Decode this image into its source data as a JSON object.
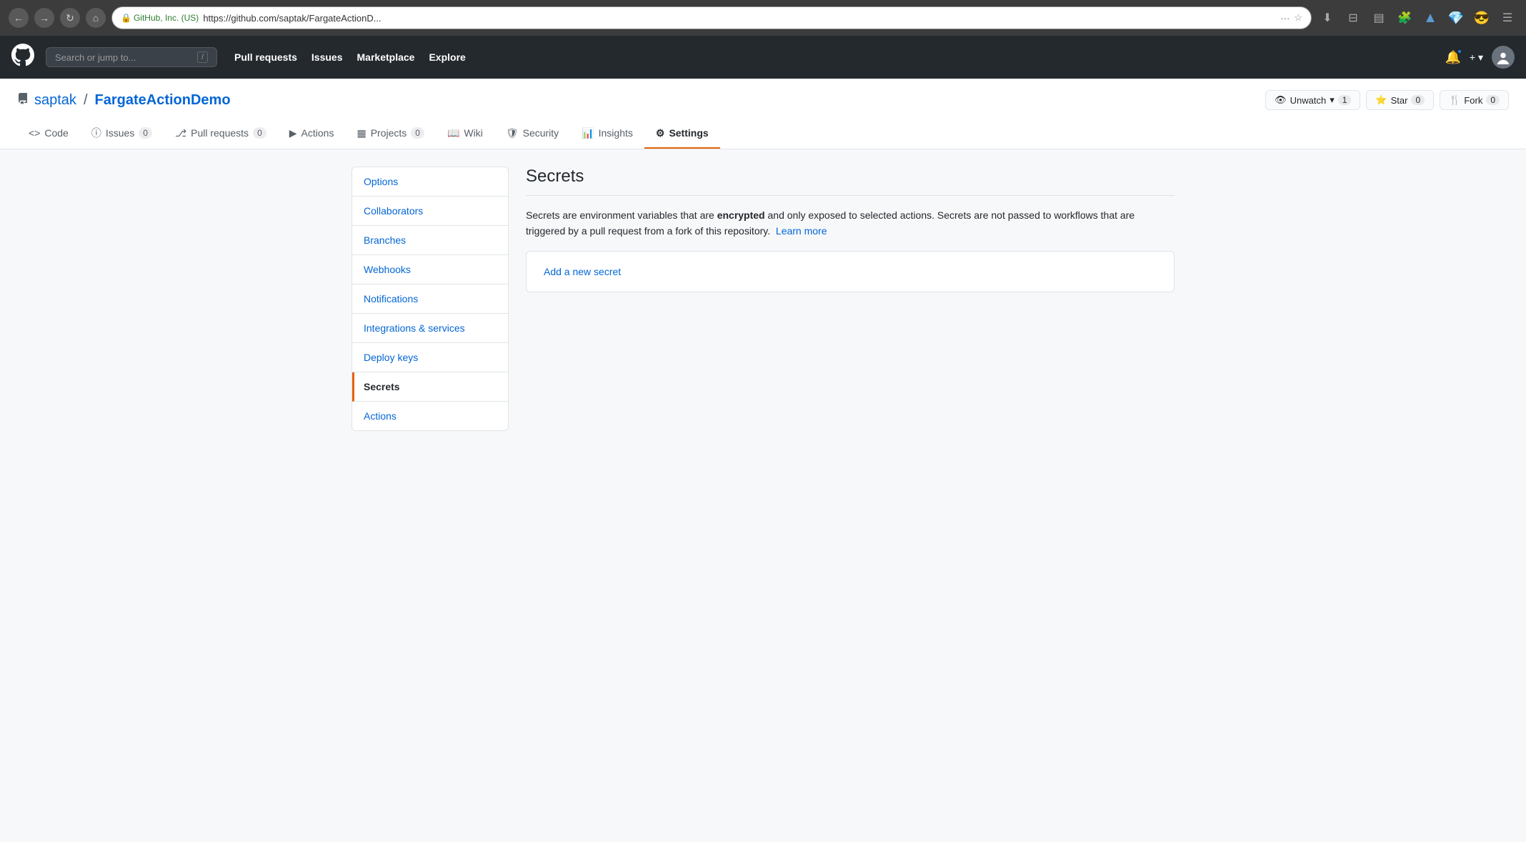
{
  "browser": {
    "url_display": "https://github.com/saptak/FargateActionD...",
    "url_full": "https://github.com/saptak/FargateActionDemo",
    "secure_text": "GitHub, Inc. (US)",
    "more_btn": "···",
    "back_icon": "←",
    "forward_icon": "→",
    "reload_icon": "↻",
    "home_icon": "⌂"
  },
  "github_header": {
    "logo": "⬤",
    "search_placeholder": "Search or jump to...",
    "search_shortcut": "/",
    "nav": [
      {
        "label": "Pull requests"
      },
      {
        "label": "Issues"
      },
      {
        "label": "Marketplace"
      },
      {
        "label": "Explore"
      }
    ],
    "plus_label": "+ ▾",
    "avatar_icon": "👤"
  },
  "repo": {
    "icon": "📋",
    "owner": "saptak",
    "name": "FargateActionDemo",
    "unwatch_label": "👁 Unwatch ▾",
    "unwatch_count": "1",
    "star_label": "⭐ Star",
    "star_count": "0",
    "fork_label": "🍴 Fork",
    "fork_count": "0"
  },
  "tabs": [
    {
      "label": "Code",
      "icon": "<>",
      "badge": null,
      "active": false
    },
    {
      "label": "Issues",
      "icon": "ⓘ",
      "badge": "0",
      "active": false
    },
    {
      "label": "Pull requests",
      "icon": "⎇",
      "badge": "0",
      "active": false
    },
    {
      "label": "Actions",
      "icon": "▶",
      "badge": null,
      "active": false
    },
    {
      "label": "Projects",
      "icon": "▦",
      "badge": "0",
      "active": false
    },
    {
      "label": "Wiki",
      "icon": "📖",
      "badge": null,
      "active": false
    },
    {
      "label": "Security",
      "icon": "🛡",
      "badge": null,
      "active": false
    },
    {
      "label": "Insights",
      "icon": "📊",
      "badge": null,
      "active": false
    },
    {
      "label": "Settings",
      "icon": "⚙",
      "badge": null,
      "active": true
    }
  ],
  "sidebar": {
    "items": [
      {
        "label": "Options",
        "active": false
      },
      {
        "label": "Collaborators",
        "active": false
      },
      {
        "label": "Branches",
        "active": false
      },
      {
        "label": "Webhooks",
        "active": false
      },
      {
        "label": "Notifications",
        "active": false
      },
      {
        "label": "Integrations & services",
        "active": false
      },
      {
        "label": "Deploy keys",
        "active": false
      },
      {
        "label": "Secrets",
        "active": true
      },
      {
        "label": "Actions",
        "active": false
      }
    ]
  },
  "secrets_page": {
    "title": "Secrets",
    "description_start": "Secrets are environment variables that are ",
    "description_bold": "encrypted",
    "description_end": " and only exposed to selected actions. Secrets are not passed to workflows that are triggered by a pull request from a fork of this repository.",
    "learn_more": "Learn more",
    "add_secret_label": "Add a new secret"
  }
}
